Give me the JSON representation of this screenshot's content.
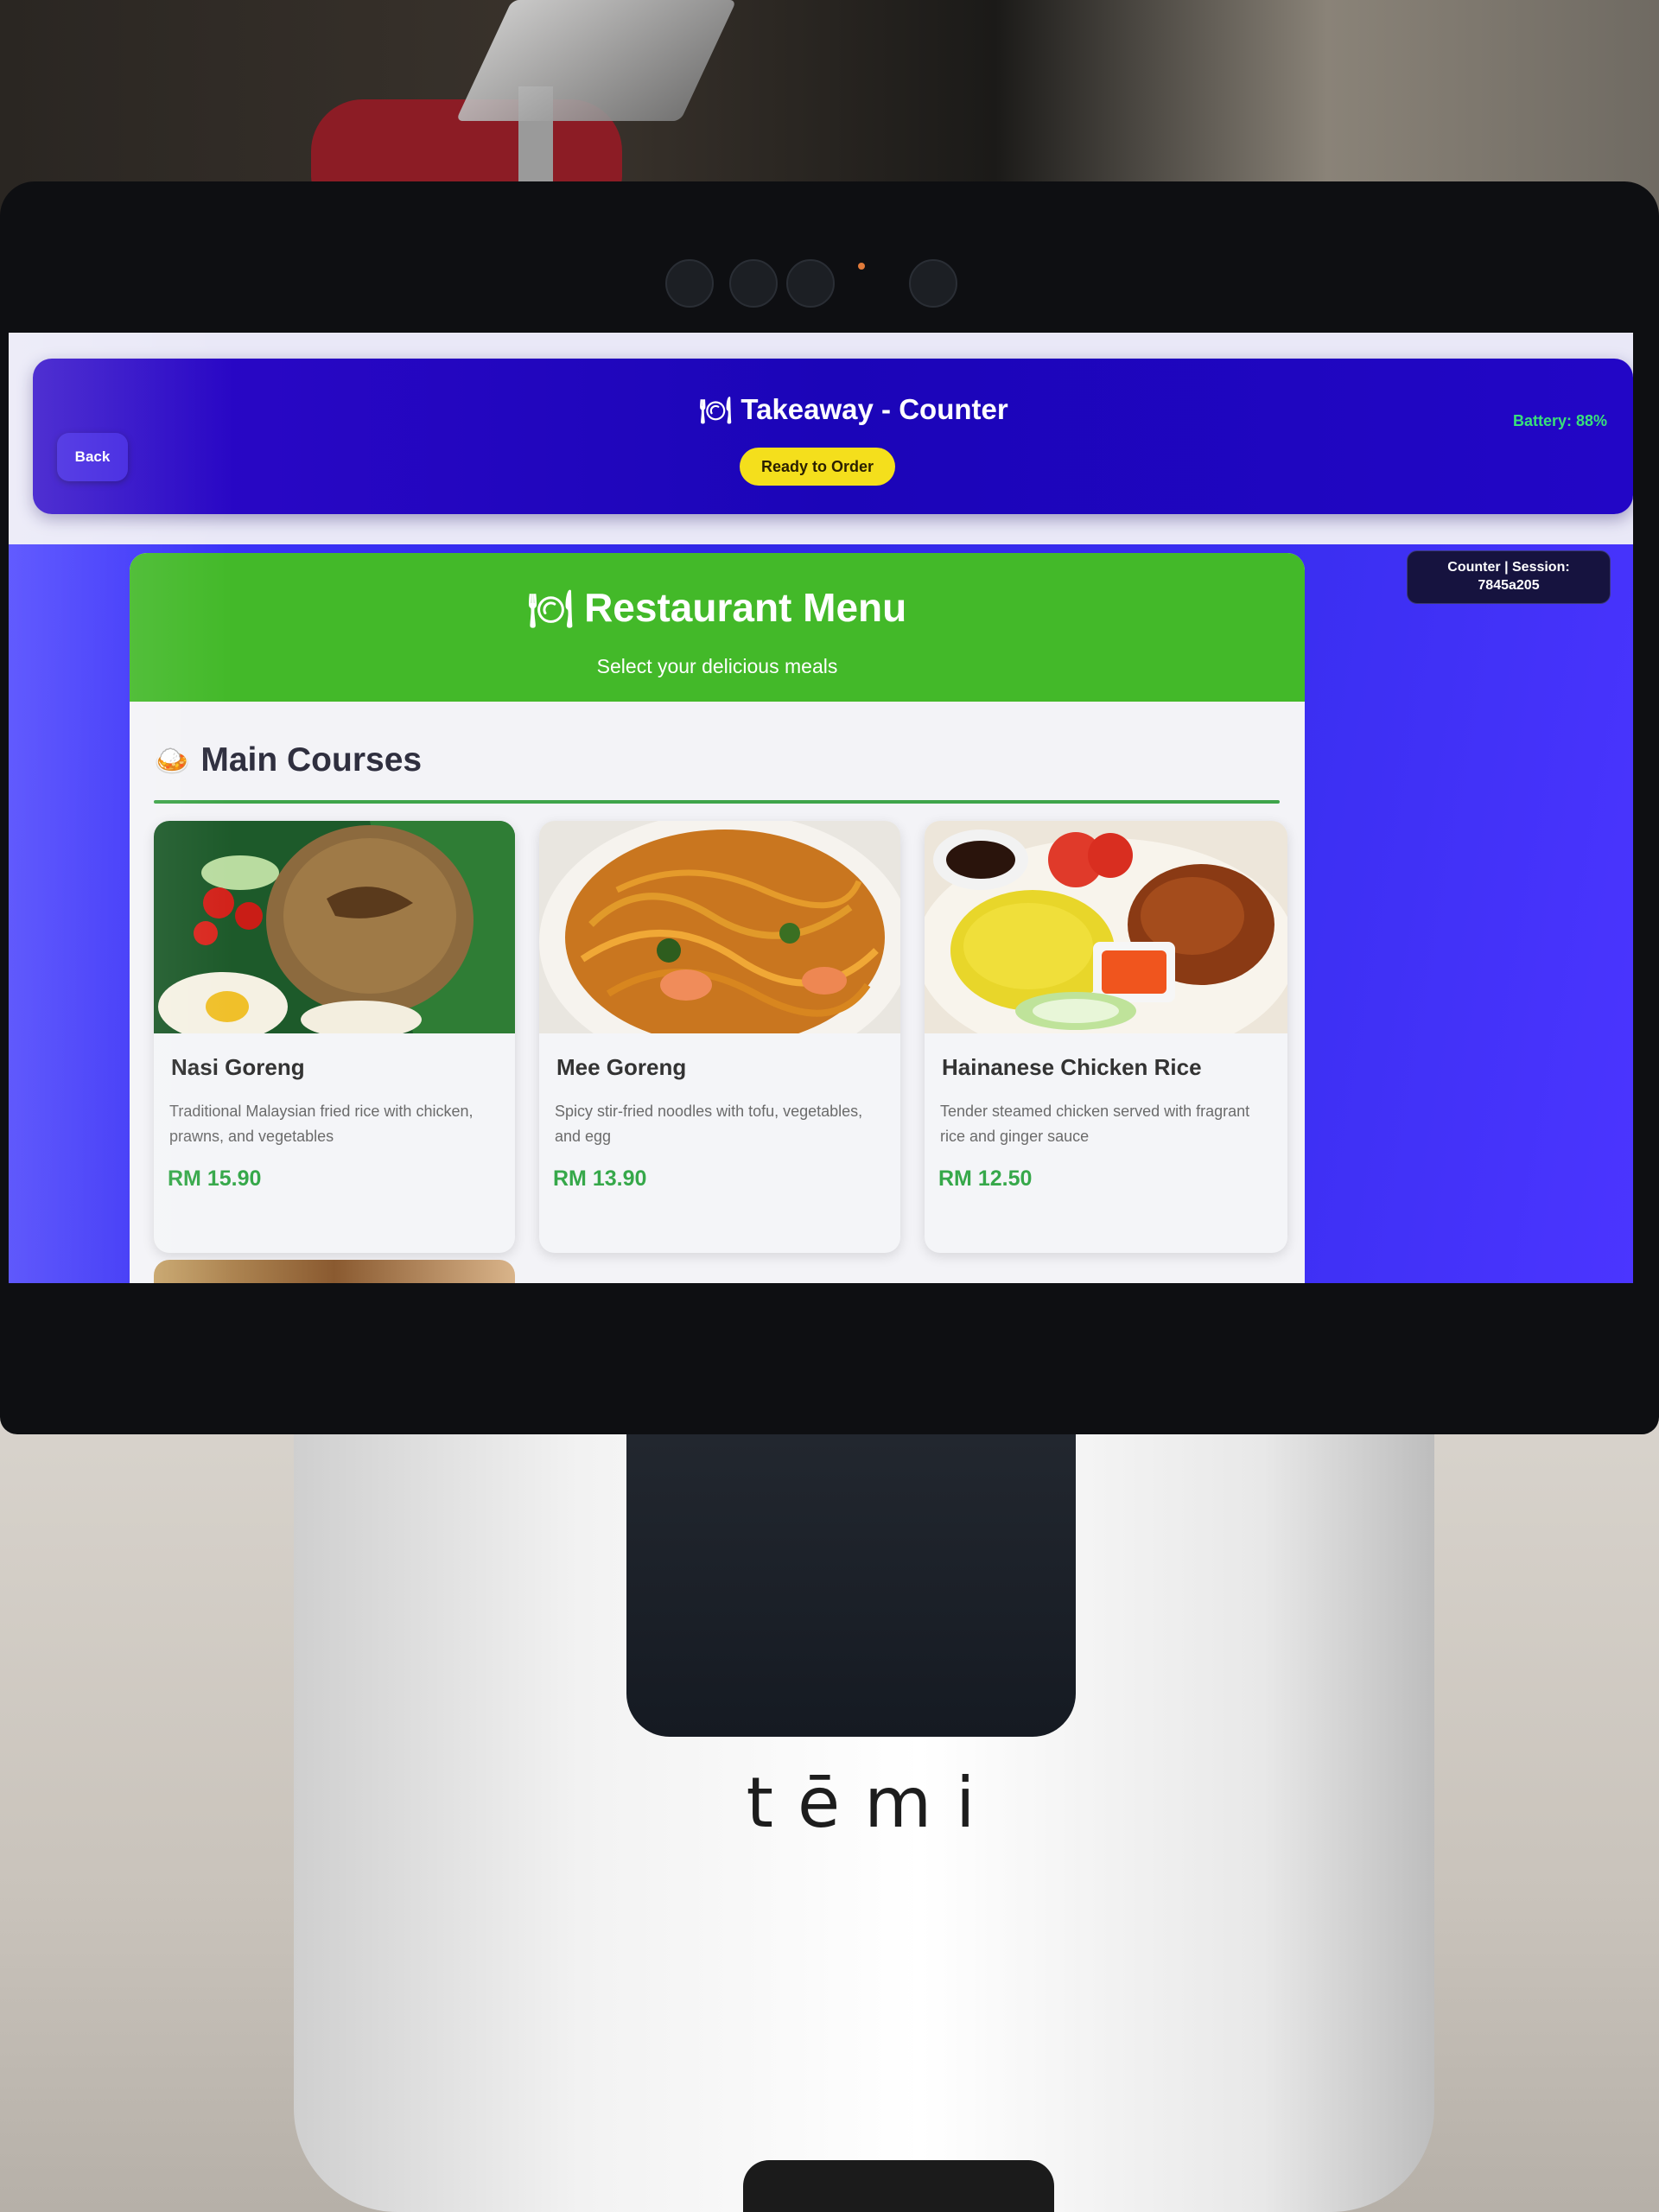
{
  "header": {
    "back_label": "Back",
    "title": "Takeaway - Counter",
    "status": "Ready to Order",
    "battery": "Battery: 88%",
    "plate_icon": "🍽"
  },
  "session": {
    "line1": "Counter | Session:",
    "line2": "7845a205"
  },
  "menu": {
    "title": "Restaurant Menu",
    "subtitle": "Select your delicious meals",
    "section_title": "Main Courses",
    "section_icon": "🍛",
    "items": [
      {
        "name": "Nasi Goreng",
        "description": "Traditional Malaysian fried rice with chicken, prawns, and vegetables",
        "price": "RM 15.90"
      },
      {
        "name": "Mee Goreng",
        "description": "Spicy stir-fried noodles with tofu, vegetables, and egg",
        "price": "RM 13.90"
      },
      {
        "name": "Hainanese Chicken Rice",
        "description": "Tender steamed chicken served with fragrant rice and ginger sauce",
        "price": "RM 12.50"
      }
    ]
  },
  "device": {
    "brand": "tēmi"
  },
  "colors": {
    "topbar": "#1b05b8",
    "status_pill": "#f4df1c",
    "battery_text": "#39e07a",
    "menu_header": "#43b929",
    "price": "#36a84a",
    "background": "#3a2ff0"
  }
}
